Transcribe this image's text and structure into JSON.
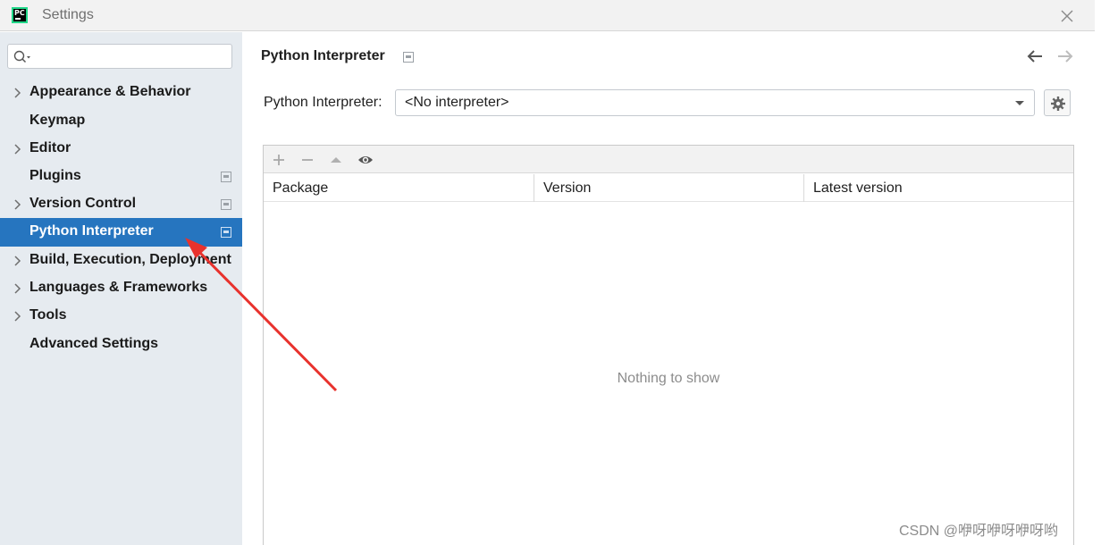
{
  "window": {
    "title": "Settings",
    "logo_text": "PC"
  },
  "search": {
    "placeholder": "",
    "value": ""
  },
  "sidebar": {
    "items": [
      {
        "label": "Appearance & Behavior",
        "expandable": true,
        "selected": false
      },
      {
        "label": "Keymap",
        "expandable": false,
        "selected": false
      },
      {
        "label": "Editor",
        "expandable": true,
        "selected": false
      },
      {
        "label": "Plugins",
        "expandable": false,
        "selected": false,
        "project_marker": true
      },
      {
        "label": "Version Control",
        "expandable": true,
        "selected": false,
        "project_marker": true
      },
      {
        "label": "Python Interpreter",
        "expandable": false,
        "selected": true,
        "project_marker": true
      },
      {
        "label": "Build, Execution, Deployment",
        "expandable": true,
        "selected": false
      },
      {
        "label": "Languages & Frameworks",
        "expandable": true,
        "selected": false
      },
      {
        "label": "Tools",
        "expandable": true,
        "selected": false
      },
      {
        "label": "Advanced Settings",
        "expandable": false,
        "selected": false
      }
    ]
  },
  "main": {
    "title": "Python Interpreter",
    "interpreter": {
      "label": "Python Interpreter:",
      "value": "<No interpreter>"
    },
    "toolbar": {
      "icons": [
        "add-icon",
        "remove-icon",
        "upgrade-icon",
        "eye-icon"
      ]
    },
    "table": {
      "columns": [
        "Package",
        "Version",
        "Latest version"
      ],
      "empty_text": "Nothing to show"
    }
  },
  "watermark": "CSDN @咿呀咿呀咿呀哟",
  "colors": {
    "sidebar_bg": "#e6ebf0",
    "selection": "#2675bf",
    "annotation_arrow": "#e8322d"
  }
}
